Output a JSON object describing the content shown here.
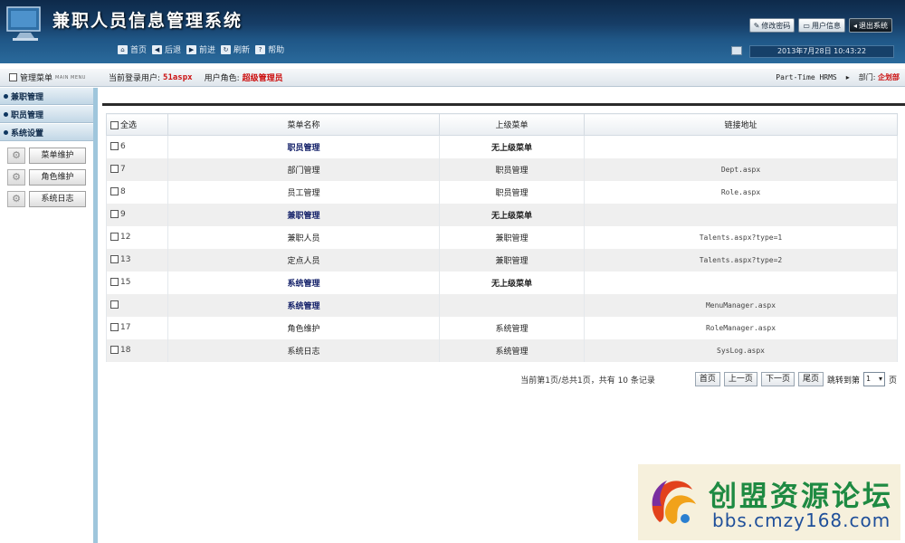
{
  "header": {
    "title": "兼职人员信息管理系统",
    "buttons": [
      {
        "label": "修改密码",
        "icon": "edit-icon"
      },
      {
        "label": "用户信息",
        "icon": "user-icon"
      },
      {
        "label": "退出系统",
        "icon": "exit-icon"
      }
    ],
    "nav": [
      {
        "label": "首页",
        "icon": "home-icon"
      },
      {
        "label": "后退",
        "icon": "back-icon"
      },
      {
        "label": "前进",
        "icon": "forward-icon"
      },
      {
        "label": "刷新",
        "icon": "refresh-icon"
      },
      {
        "label": "帮助",
        "icon": "help-icon"
      }
    ],
    "datetime": "2013年7月28日 10:43:22"
  },
  "info_bar": {
    "menu_label": "管理菜单",
    "menu_sub": "MAIN MENU",
    "current_user_label": "当前登录用户:",
    "current_user": "51aspx",
    "role_label": "用户角色:",
    "role": "超级管理员",
    "system_name": "Part-Time HRMS",
    "dept_label": "部门:",
    "dept": "企划部"
  },
  "sidebar": {
    "groups": [
      "兼职管理",
      "职员管理",
      "系统设置"
    ],
    "sub_items": [
      "菜单维护",
      "角色维护",
      "系统日志"
    ]
  },
  "grid": {
    "headers": [
      "全选",
      "菜单名称",
      "上级菜单",
      "链接地址"
    ],
    "rows": [
      {
        "id": "6",
        "name": "职员管理",
        "parent": "无上级菜单",
        "url": "",
        "bold": true
      },
      {
        "id": "7",
        "name": "部门管理",
        "parent": "职员管理",
        "url": "Dept.aspx",
        "bold": false
      },
      {
        "id": "8",
        "name": "员工管理",
        "parent": "职员管理",
        "url": "Role.aspx",
        "bold": false
      },
      {
        "id": "9",
        "name": "兼职管理",
        "parent": "无上级菜单",
        "url": "",
        "bold": true
      },
      {
        "id": "12",
        "name": "兼职人员",
        "parent": "兼职管理",
        "url": "Talents.aspx?type=1",
        "bold": false
      },
      {
        "id": "13",
        "name": "定点人员",
        "parent": "兼职管理",
        "url": "Talents.aspx?type=2",
        "bold": false
      },
      {
        "id": "15",
        "name": "系统管理",
        "parent": "无上级菜单",
        "url": "",
        "bold": true
      },
      {
        "id": "",
        "name": "系统管理",
        "parent": "",
        "url": "MenuManager.aspx",
        "bold": true
      },
      {
        "id": "17",
        "name": "角色维护",
        "parent": "系统管理",
        "url": "RoleManager.aspx",
        "bold": false
      },
      {
        "id": "18",
        "name": "系统日志",
        "parent": "系统管理",
        "url": "SysLog.aspx",
        "bold": false
      }
    ]
  },
  "pager": {
    "summary": "当前第1页/总共1页，共有 10 条记录",
    "first": "首页",
    "prev": "上一页",
    "next": "下一页",
    "last": "尾页",
    "jump_label": "跳转到第",
    "page_value": "1",
    "page_suffix": "页"
  },
  "watermark": {
    "text": "创盟资源论坛",
    "url": "bbs.cmzy168.com"
  },
  "colors": {
    "header_dark": "#0e2a4a",
    "accent_red": "#cc1010",
    "sidebar_border": "#9fc6dc",
    "watermark_green": "#1e8a42",
    "watermark_blue": "#1f4f9a"
  }
}
